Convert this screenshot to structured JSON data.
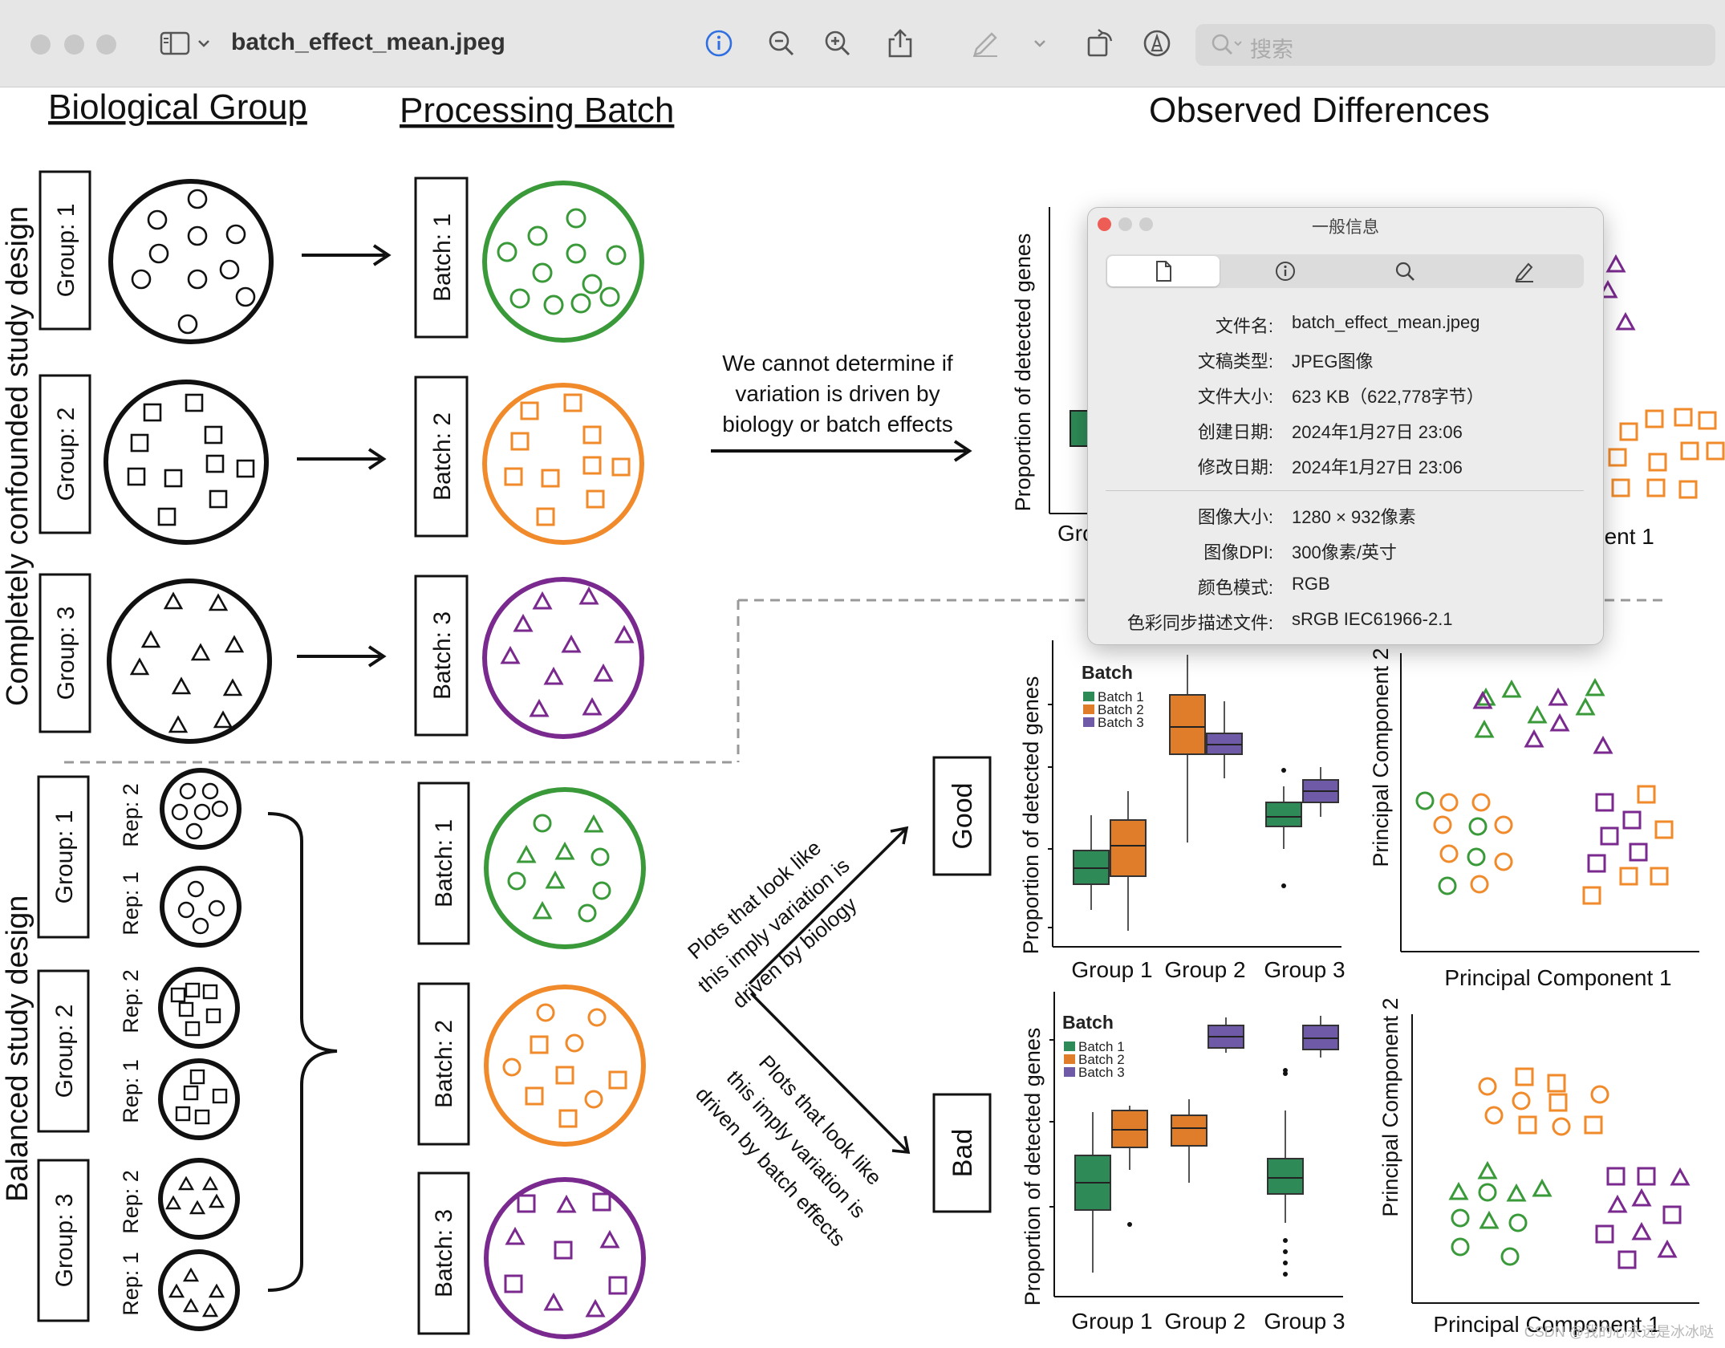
{
  "toolbar": {
    "filename": "batch_effect_mean.jpeg",
    "search_placeholder": "搜索",
    "icons": [
      "sidebar-icon",
      "chevron-down-icon",
      "info-icon",
      "zoom-out-icon",
      "zoom-in-icon",
      "share-icon",
      "markup-pen-icon",
      "chevron-down-icon",
      "rotate-icon",
      "annotate-icon",
      "search-icon"
    ]
  },
  "figure": {
    "header_bio": "Biological Group",
    "header_batch": "Processing Batch",
    "header_obs": "Observed Differences",
    "side_confounded": "Completely confounded study design",
    "side_balanced": "Balanced study design",
    "groups": [
      "Group: 1",
      "Group: 2",
      "Group: 3"
    ],
    "batches": [
      "Batch: 1",
      "Batch: 2",
      "Batch: 3"
    ],
    "rep1": "Rep: 1",
    "rep2": "Rep: 2",
    "note_lines": [
      "We cannot determine if",
      "variation is driven by",
      "biology or batch effects"
    ],
    "arrow_good_lines": [
      "Plots that look like",
      "this imply variation is",
      "driven by biology"
    ],
    "arrow_bad_lines": [
      "Plots that look like",
      "this imply variation is",
      "driven by batch effects"
    ],
    "good": "Good",
    "bad": "Bad",
    "y_label": "Proportion of detected genes",
    "pc1": "Principal Component 1",
    "pc2": "Principal Component 2",
    "top_frag_x": "Gro",
    "top_frag_pc": "nent 1",
    "legend_title": "Batch",
    "legend_items": [
      "Batch 1",
      "Batch 2",
      "Batch 3"
    ],
    "colors": {
      "batch1": "#2e8b57",
      "batch2": "#e07d2a",
      "batch3": "#6f5aa8",
      "green": "#3a9a3a",
      "orange": "#f08a2a",
      "purple": "#7a2a8e"
    }
  },
  "chart_data": [
    {
      "type": "box",
      "chart": "good-boxplot",
      "categories": [
        "Group 1",
        "Group 2",
        "Group 3"
      ],
      "legend_title": "Batch",
      "series": [
        {
          "name": "Batch 1",
          "values": [
            0.42,
            null,
            0.53
          ]
        },
        {
          "name": "Batch 2",
          "values": [
            0.46,
            0.72,
            null
          ]
        },
        {
          "name": "Batch 3",
          "values": [
            null,
            0.68,
            0.58
          ]
        }
      ]
    },
    {
      "type": "box",
      "chart": "bad-boxplot",
      "categories": [
        "Group 1",
        "Group 2",
        "Group 3"
      ],
      "legend_title": "Batch",
      "series": [
        {
          "name": "Batch 1",
          "values": [
            0.35,
            null,
            0.38
          ]
        },
        {
          "name": "Batch 2",
          "values": [
            0.55,
            0.55,
            null
          ]
        },
        {
          "name": "Batch 3",
          "values": [
            null,
            0.88,
            0.88
          ]
        }
      ]
    }
  ],
  "info_panel": {
    "title": "一般信息",
    "tabs": [
      "document-icon",
      "info-icon",
      "search-icon",
      "pencil-icon"
    ],
    "rows": [
      {
        "label": "文件名:",
        "value": "batch_effect_mean.jpeg"
      },
      {
        "label": "文稿类型:",
        "value": "JPEG图像"
      },
      {
        "label": "文件大小:",
        "value": "623 KB（622,778字节）"
      },
      {
        "label": "创建日期:",
        "value": "2024年1月27日 23:06"
      },
      {
        "label": "修改日期:",
        "value": "2024年1月27日 23:06"
      },
      {
        "label": "图像大小:",
        "value": "1280 × 932像素"
      },
      {
        "label": "图像DPI:",
        "value": "300像素/英寸"
      },
      {
        "label": "颜色模式:",
        "value": "RGB"
      },
      {
        "label": "色彩同步描述文件:",
        "value": "sRGB IEC61966-2.1"
      }
    ]
  },
  "watermark": "CSDN @我的心永远是冰冰哒"
}
